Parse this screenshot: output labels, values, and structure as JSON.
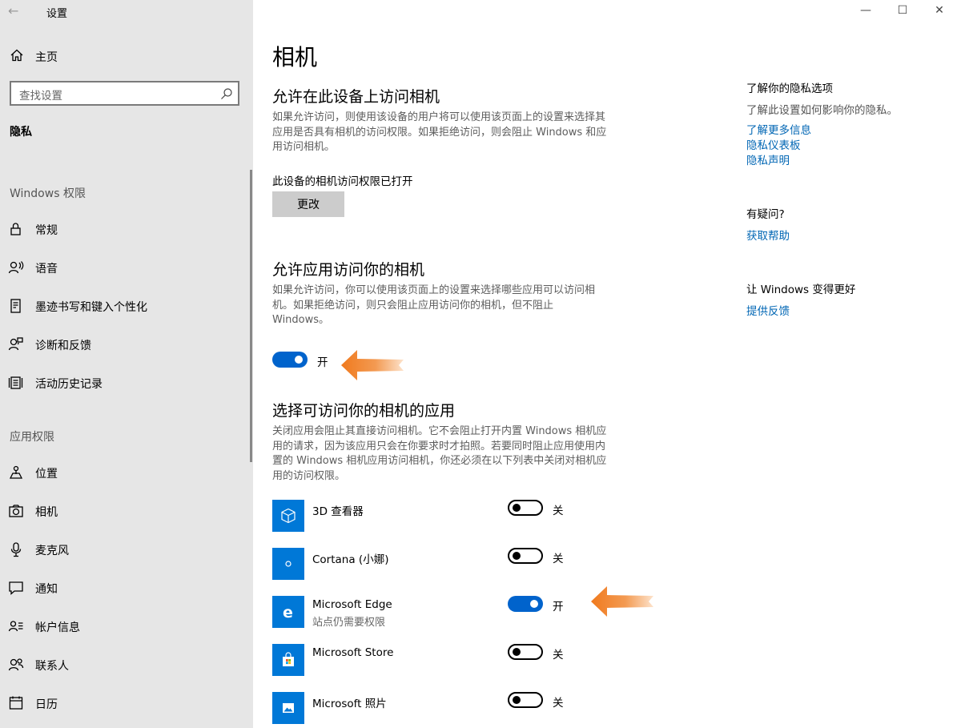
{
  "window": {
    "title": "设置",
    "back_icon": "←",
    "min_icon": "—",
    "max_icon": "☐",
    "close_icon": "✕"
  },
  "sidebar": {
    "home_label": "主页",
    "search_placeholder": "查找设置",
    "active_section": "隐私",
    "groups": [
      {
        "label": "Windows 权限",
        "items": [
          {
            "label": "常规",
            "icon": "lock-icon"
          },
          {
            "label": "语音",
            "icon": "speech-icon"
          },
          {
            "label": "墨迹书写和键入个性化",
            "icon": "inking-icon"
          },
          {
            "label": "诊断和反馈",
            "icon": "diagnostics-icon"
          },
          {
            "label": "活动历史记录",
            "icon": "activity-history-icon"
          }
        ]
      },
      {
        "label": "应用权限",
        "items": [
          {
            "label": "位置",
            "icon": "location-icon"
          },
          {
            "label": "相机",
            "icon": "camera-icon"
          },
          {
            "label": "麦克风",
            "icon": "microphone-icon"
          },
          {
            "label": "通知",
            "icon": "notification-icon"
          },
          {
            "label": "帐户信息",
            "icon": "account-info-icon"
          },
          {
            "label": "联系人",
            "icon": "contacts-icon"
          },
          {
            "label": "日历",
            "icon": "calendar-icon"
          }
        ]
      }
    ]
  },
  "main": {
    "title": "相机",
    "device_section": {
      "heading": "允许在此设备上访问相机",
      "desc_lines": [
        "如果允许访问，则使用该设备的用户将可以使用该页面上的设置来选择其",
        "应用是否具有相机的访问权限。如果拒绝访问，则会阻止 Windows 和应",
        "用访问相机。"
      ],
      "status": "此设备的相机访问权限已打开",
      "change_button": "更改"
    },
    "apps_section": {
      "heading": "允许应用访问你的相机",
      "desc_lines": [
        "如果允许访问，你可以使用该页面上的设置来选择哪些应用可以访问相",
        "机。如果拒绝访问，则只会阻止应用访问你的相机，但不阻止",
        "Windows。"
      ],
      "toggle_on": true,
      "toggle_label": "开"
    },
    "choose_section": {
      "heading": "选择可访问你的相机的应用",
      "desc_lines": [
        "关闭应用会阻止其直接访问相机。它不会阻止打开内置 Windows 相机应",
        "用的请求，因为该应用只会在你要求时才拍照。若要同时阻止应用使用内",
        "置的 Windows 相机应用访问相机，你还必须在以下列表中关闭对相机应",
        "用的访问权限。"
      ],
      "apps": [
        {
          "name": "3D 查看器",
          "sub": "",
          "on": false,
          "state_label": "关",
          "icon": "3d-viewer-icon"
        },
        {
          "name": "Cortana (小娜)",
          "sub": "",
          "on": false,
          "state_label": "关",
          "icon": "cortana-icon"
        },
        {
          "name": "Microsoft Edge",
          "sub": "站点仍需要权限",
          "on": true,
          "state_label": "开",
          "icon": "edge-icon"
        },
        {
          "name": "Microsoft Store",
          "sub": "",
          "on": false,
          "state_label": "关",
          "icon": "store-icon"
        },
        {
          "name": "Microsoft 照片",
          "sub": "",
          "on": false,
          "state_label": "关",
          "icon": "photos-icon"
        }
      ]
    }
  },
  "right": {
    "privacy": {
      "heading": "了解你的隐私选项",
      "text": "了解此设置如何影响你的隐私。",
      "links": [
        "了解更多信息",
        "隐私仪表板",
        "隐私声明"
      ]
    },
    "help": {
      "heading": "有疑问?",
      "link": "获取帮助"
    },
    "feedback": {
      "heading": "让 Windows 变得更好",
      "link": "提供反馈"
    }
  },
  "colors": {
    "toggle_on": "#0063cc",
    "app_icon_bg": "#0078d7",
    "link": "#0066b4",
    "annotation_arrow": "#f07a1e"
  }
}
